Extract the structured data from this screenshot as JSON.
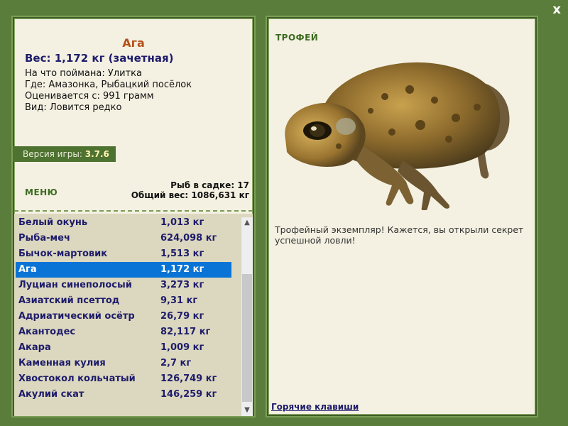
{
  "window": {
    "close_label": "x"
  },
  "fish": {
    "title": "Ага",
    "weight_line": "Вес: 1,172 кг (зачетная)",
    "caught_with": "На что поймана: Улитка",
    "location": "Где: Амазонка, Рыбацкий посёлок",
    "rated_from": "Оценивается с: 991 грамм",
    "kind": "Вид: Ловится редко"
  },
  "version": {
    "label": "Версия игры:",
    "number": "3.7.6"
  },
  "menu": {
    "label": "МЕНЮ"
  },
  "stats": {
    "fish_in_keepnet": "Рыб в садке: 17",
    "total_weight": "Общий вес: 1086,631 кг"
  },
  "fish_list": [
    {
      "name": "Белый окунь",
      "weight": "1,013 кг",
      "selected": false
    },
    {
      "name": "Рыба-меч",
      "weight": "624,098 кг",
      "selected": false
    },
    {
      "name": "Бычок-мартовик",
      "weight": "1,513 кг",
      "selected": false
    },
    {
      "name": "Ага",
      "weight": "1,172 кг",
      "selected": true
    },
    {
      "name": "Луциан синеполосый",
      "weight": "3,273 кг",
      "selected": false
    },
    {
      "name": "Азиатский псеттод",
      "weight": "9,31 кг",
      "selected": false
    },
    {
      "name": "Адриатический осётр",
      "weight": "26,79 кг",
      "selected": false
    },
    {
      "name": "Акантодес",
      "weight": "82,117 кг",
      "selected": false
    },
    {
      "name": "Акара",
      "weight": "1,009 кг",
      "selected": false
    },
    {
      "name": "Каменная кулия",
      "weight": "2,7 кг",
      "selected": false
    },
    {
      "name": "Хвостокол кольчатый",
      "weight": "126,749 кг",
      "selected": false
    },
    {
      "name": "Акулий скат",
      "weight": "146,259 кг",
      "selected": false
    }
  ],
  "trophy": {
    "label": "ТРОФЕЙ",
    "text": "Трофейный экземпляр! Кажется, вы открыли секрет успешной ловли!",
    "hotkeys": "Горячие клавиши"
  },
  "icons": {
    "close": "close-icon",
    "scroll_up": "chevron-up-icon",
    "scroll_down": "chevron-down-icon"
  },
  "colors": {
    "background": "#5b7d3b",
    "panel": "#f4f1e2",
    "title": "#b5501a",
    "text_navy": "#1e1c6b",
    "selection": "#0a74d6"
  }
}
